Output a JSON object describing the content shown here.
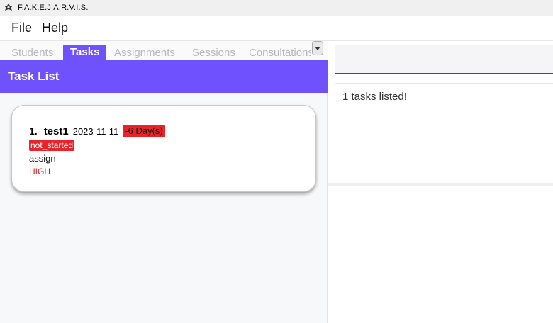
{
  "window": {
    "title": "F.A.K.E.J.A.R.V.I.S.",
    "icon": "leaf-icon"
  },
  "menu": {
    "file": "File",
    "help": "Help"
  },
  "tabs": [
    {
      "label": "Students",
      "active": false
    },
    {
      "label": "Tasks",
      "active": true
    },
    {
      "label": "Assignments",
      "active": false
    },
    {
      "label": "Sessions",
      "active": false
    },
    {
      "label": "Consultations",
      "active": false
    }
  ],
  "list": {
    "title": "Task List"
  },
  "tasks": [
    {
      "index": "1.",
      "name": "test1",
      "date": "2023-11-11",
      "due": "-6 Day(s)",
      "status": "not_started",
      "assignment": "assign",
      "priority": "HIGH"
    }
  ],
  "command": {
    "value": ""
  },
  "result": {
    "message": "1 tasks listed!"
  },
  "colors": {
    "accent": "#7052fd",
    "badge_red": "#e8232a",
    "priority_high": "#d81e1e"
  }
}
